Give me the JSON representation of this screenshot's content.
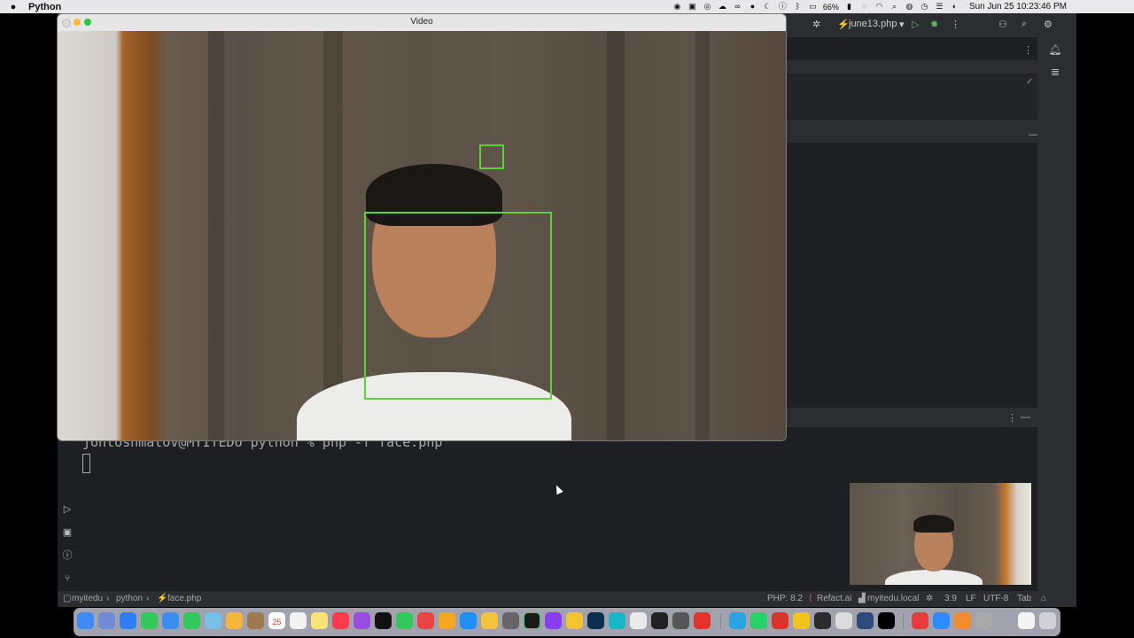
{
  "menubar": {
    "app_name": "Python",
    "battery_percent": "66%",
    "clock": "Sun Jun 25  10:23:46 PM"
  },
  "video_window": {
    "title": "Video",
    "detections": {
      "face": "face rectangle",
      "small": "small detection rectangle"
    }
  },
  "ide": {
    "toolbar": {
      "file_label": "june13.php"
    },
    "terminal": {
      "command_line": "jontoshmatov@MYITEDU python % php -f face.php"
    },
    "breadcrumb": [
      "myitedu",
      "python",
      "face.php"
    ],
    "status": {
      "php_version": "PHP: 8.2",
      "refact": "Refact.ai",
      "host": "myitedu.local",
      "position": "3:9",
      "line_ending": "LF",
      "encoding": "UTF-8",
      "indent": "Tab"
    }
  },
  "dock": {
    "calendar_day": "25"
  },
  "colors": {
    "detection_box": "#5ed13a",
    "ide_bg": "#1e1f22",
    "ide_panel": "#2b2d30"
  }
}
